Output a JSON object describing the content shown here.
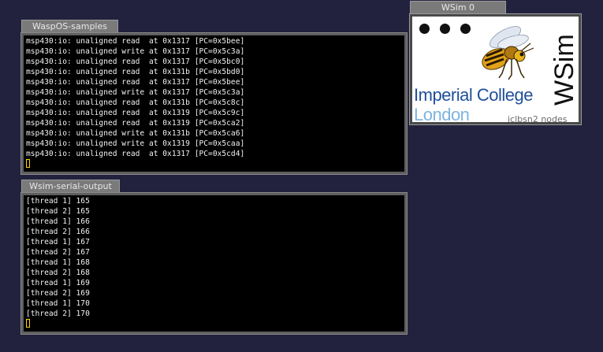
{
  "windows": {
    "wasp": {
      "title": "WaspOS-samples",
      "lines": [
        "msp430:io: unaligned read  at 0x1317 [PC=0x5bee]",
        "msp430:io: unaligned write at 0x1317 [PC=0x5c3a]",
        "msp430:io: unaligned read  at 0x1317 [PC=0x5bc0]",
        "msp430:io: unaligned read  at 0x131b [PC=0x5bd0]",
        "msp430:io: unaligned read  at 0x1317 [PC=0x5bee]",
        "msp430:io: unaligned write at 0x1317 [PC=0x5c3a]",
        "msp430:io: unaligned read  at 0x131b [PC=0x5c8c]",
        "msp430:io: unaligned read  at 0x1319 [PC=0x5c9c]",
        "msp430:io: unaligned read  at 0x1319 [PC=0x5ca2]",
        "msp430:io: unaligned write at 0x131b [PC=0x5ca6]",
        "msp430:io: unaligned write at 0x1319 [PC=0x5caa]",
        "msp430:io: unaligned read  at 0x1317 [PC=0x5cd4]"
      ]
    },
    "serial": {
      "title": "Wsim-serial-output",
      "lines": [
        "[thread 1] 165",
        "[thread 2] 165",
        "[thread 1] 166",
        "[thread 2] 166",
        "[thread 1] 167",
        "[thread 2] 167",
        "[thread 1] 168",
        "[thread 2] 168",
        "[thread 1] 169",
        "[thread 2] 169",
        "[thread 1] 170",
        "[thread 2] 170"
      ]
    },
    "wsim": {
      "title": "WSim 0",
      "logo_line1": "Imperial College",
      "logo_line2": "London",
      "caption": "iclbsn2 nodes",
      "brand": "WSim",
      "icon": "wasp-icon"
    }
  },
  "colors": {
    "desktop": "#22223f",
    "terminal_bg": "#000000",
    "terminal_fg": "#f2f2f2",
    "cursor": "#ffd800",
    "imperial_blue": "#1f4f9a",
    "london_blue": "#7db5df"
  }
}
